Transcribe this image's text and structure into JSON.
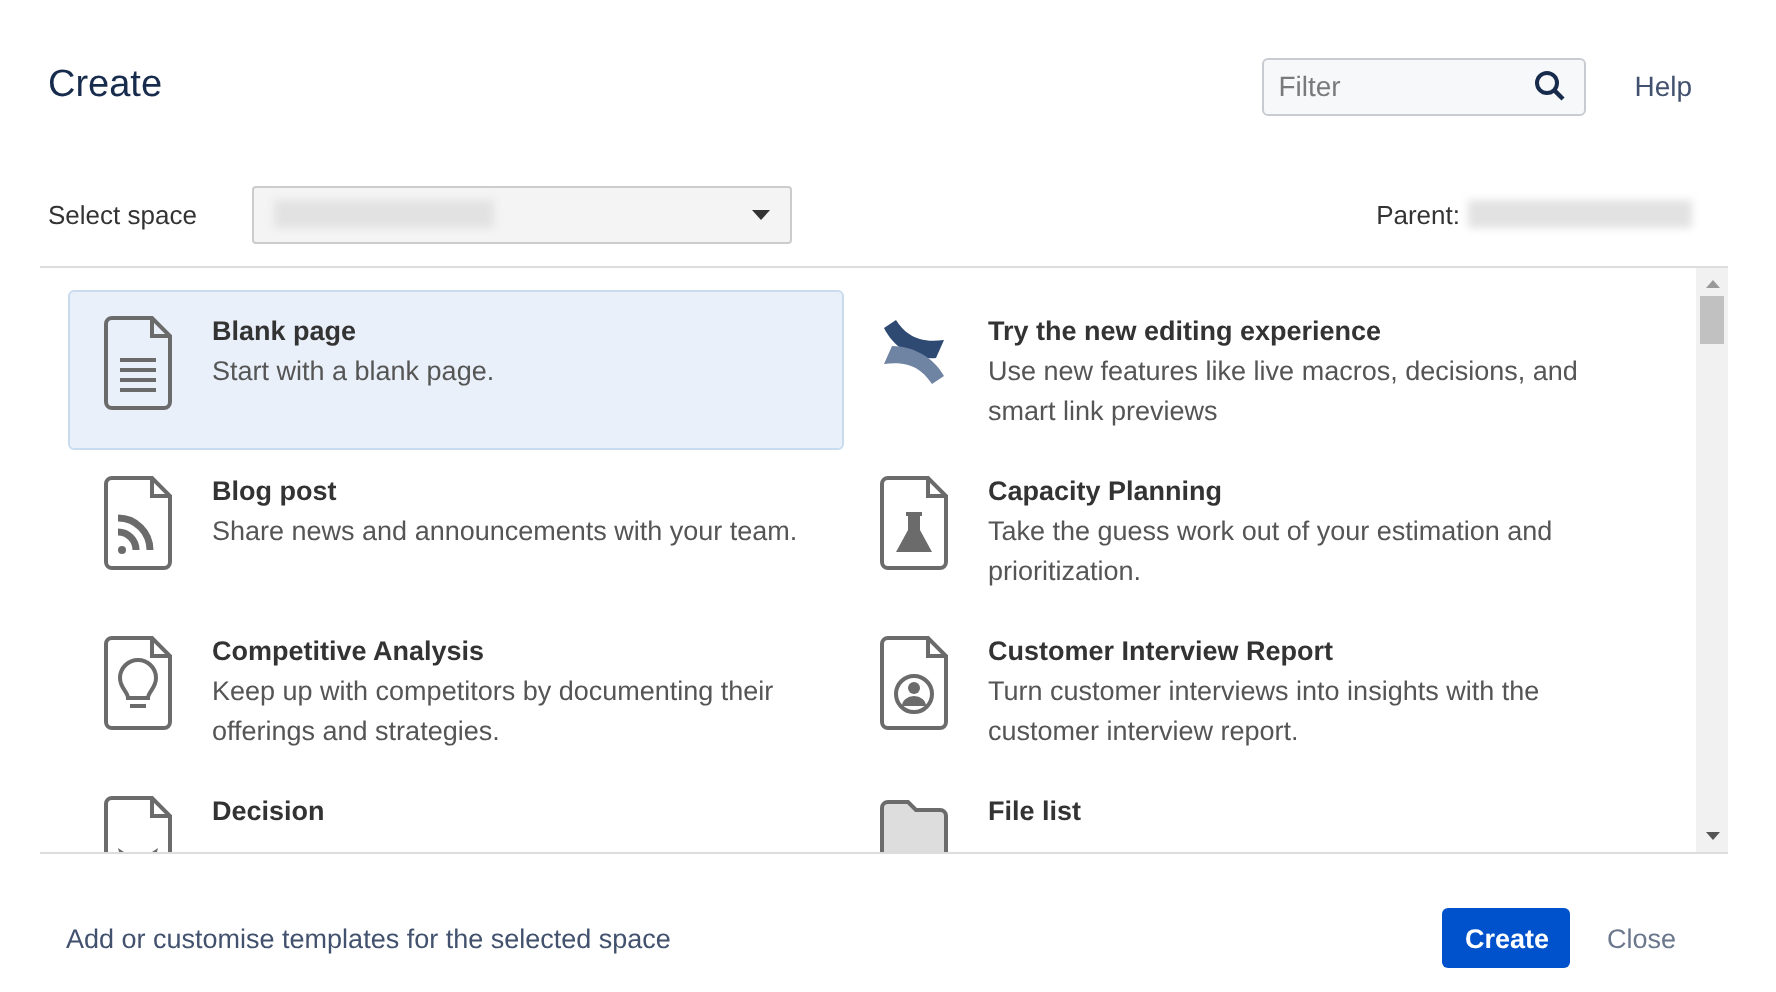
{
  "dialog": {
    "title": "Create",
    "filter": {
      "placeholder": "Filter"
    },
    "help": "Help"
  },
  "space": {
    "label": "Select space",
    "parent_label": "Parent:"
  },
  "templates": [
    {
      "kind": "blank",
      "title": "Blank page",
      "description": "Start with a blank page.",
      "selected": true
    },
    {
      "kind": "editor",
      "title": "Try the new editing experience",
      "description": "Use new features like live macros, decisions, and smart link previews",
      "selected": false
    },
    {
      "kind": "blog",
      "title": "Blog post",
      "description": "Share news and announcements with your team.",
      "selected": false
    },
    {
      "kind": "flask",
      "title": "Capacity Planning",
      "description": "Take the guess work out of your estimation and prioritization.",
      "selected": false
    },
    {
      "kind": "bulb",
      "title": "Competitive Analysis",
      "description": "Keep up with competitors by documenting their offerings and strategies.",
      "selected": false
    },
    {
      "kind": "person",
      "title": "Customer Interview Report",
      "description": "Turn customer interviews into insights with the customer interview report.",
      "selected": false
    },
    {
      "kind": "decision",
      "title": "Decision",
      "selected": false
    },
    {
      "kind": "files",
      "title": "File list",
      "selected": false
    }
  ],
  "footer": {
    "link": "Add or customise templates for the selected space",
    "buttons": [
      {
        "kind": "primary",
        "label": "Create"
      },
      {
        "kind": "link",
        "label": "Close"
      }
    ]
  }
}
